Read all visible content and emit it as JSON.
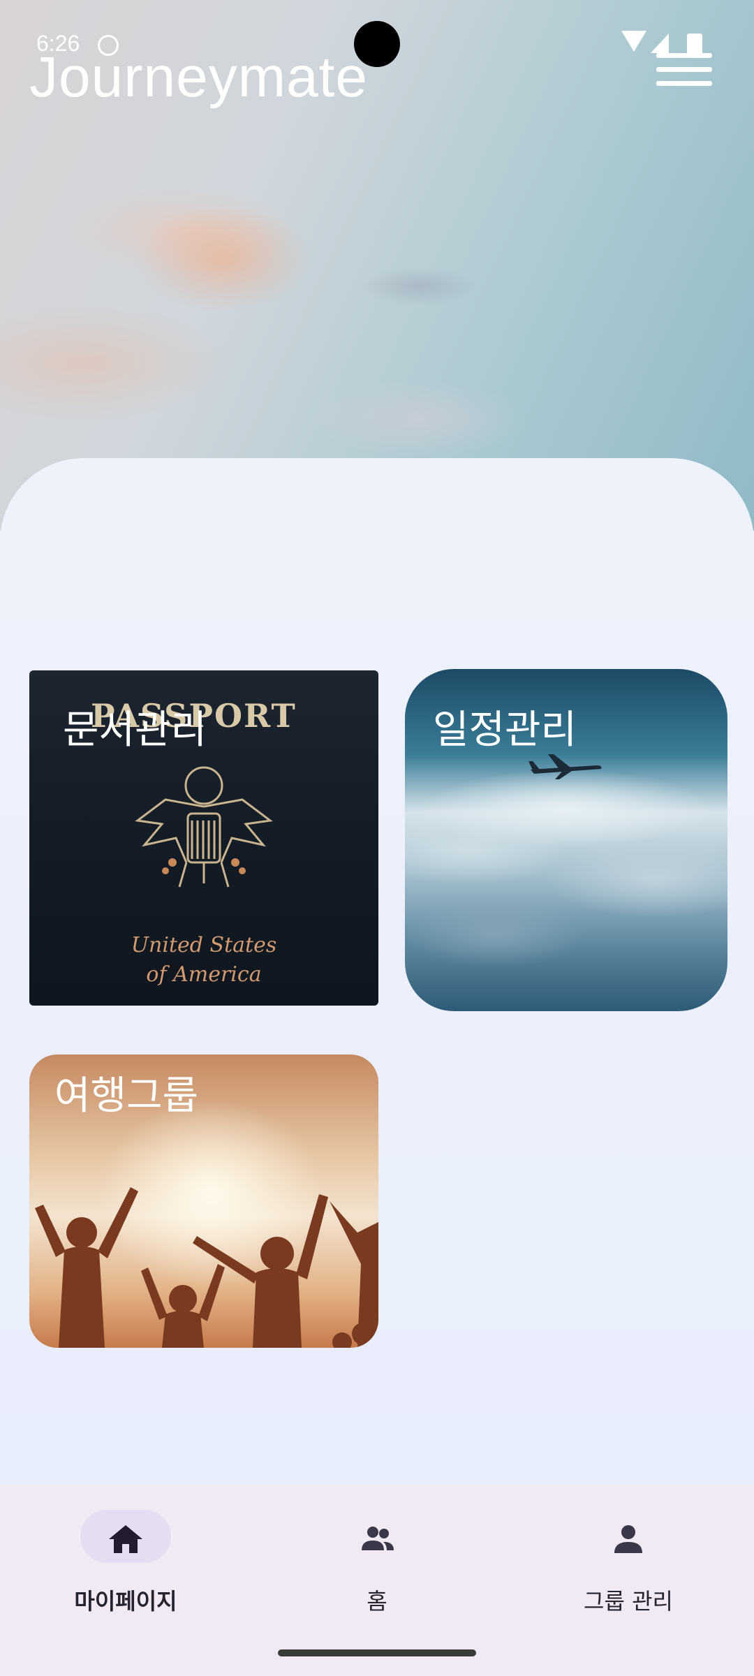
{
  "status_bar": {
    "time": "6:26",
    "icons": [
      "sync-icon",
      "wifi-icon",
      "signal-icon",
      "battery-icon"
    ]
  },
  "app_bar": {
    "title": "Journeymate",
    "menu_icon": "hamburger-menu-icon"
  },
  "cards": {
    "documents": {
      "label": "문서관리",
      "image_text_title": "PASSPORT",
      "image_text_line1": "United States",
      "image_text_line2": "of America"
    },
    "schedule": {
      "label": "일정관리"
    },
    "group": {
      "label": "여행그룹"
    }
  },
  "bottom_nav": {
    "items": [
      {
        "label": "마이페이지",
        "icon": "home-icon",
        "active": true
      },
      {
        "label": "홈",
        "icon": "group-icon",
        "active": false
      },
      {
        "label": "그룹 관리",
        "icon": "person-icon",
        "active": false
      }
    ]
  },
  "colors": {
    "panel_background": "#eef2fb",
    "nav_background": "#f1eaf4",
    "nav_active_pill": "#e5ddf2",
    "title_text": "#ffffff"
  }
}
